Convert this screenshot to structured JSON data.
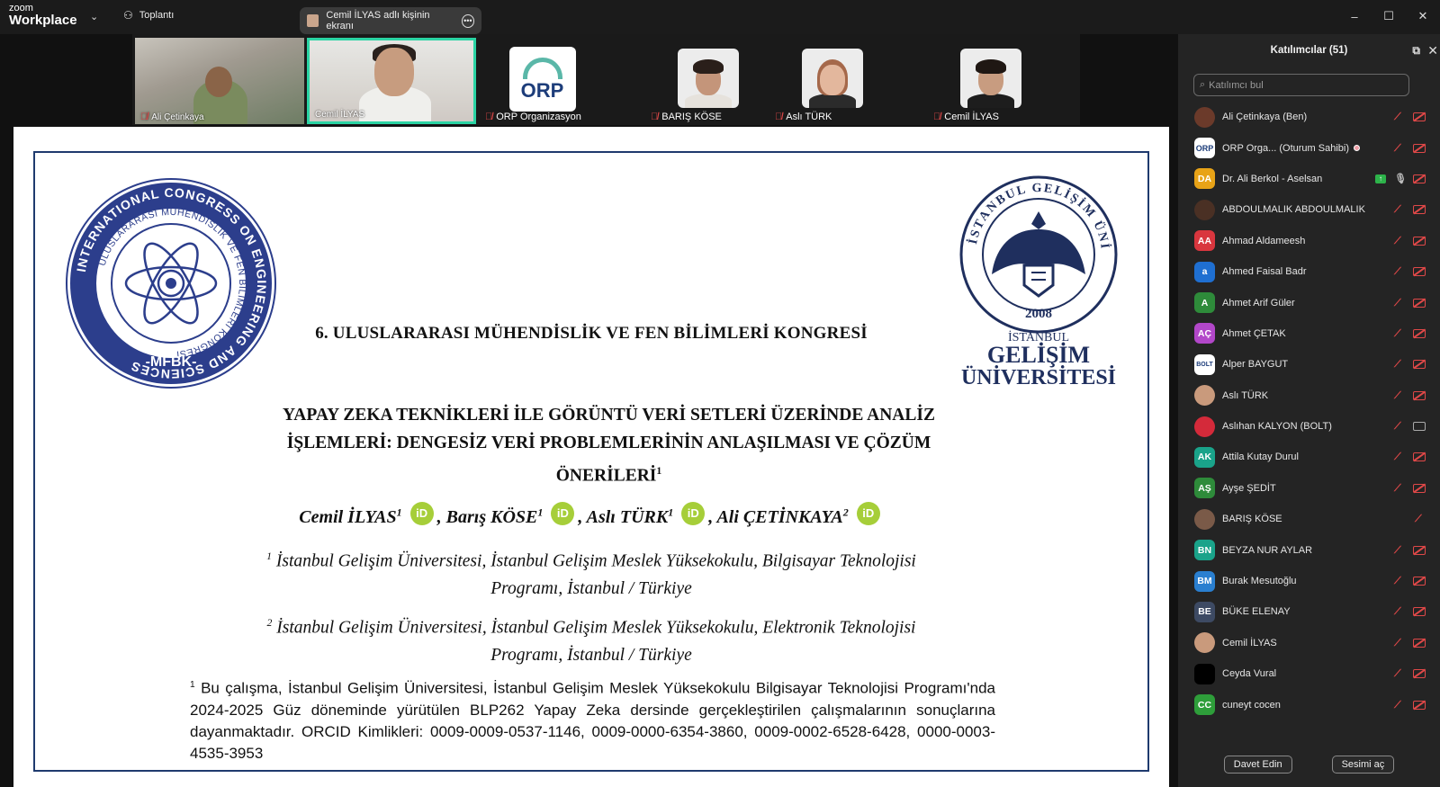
{
  "app": {
    "brand_small": "zoom",
    "brand_large": "Workplace",
    "meeting_menu_label": "Toplantı",
    "share_banner": "Cemil İLYAS adlı kişinin ekranı"
  },
  "video_strip": {
    "tiles": [
      {
        "name": "Ali Çetinkaya",
        "muted": true
      },
      {
        "name": "Cemil İLYAS",
        "muted": false,
        "active_speaker": true
      },
      {
        "name": "ORP Organizasyon",
        "muted": true,
        "logo_text": "ORP"
      },
      {
        "name": "BARIŞ KÖSE",
        "muted": true
      },
      {
        "name": "Aslı TÜRK",
        "muted": true
      },
      {
        "name": "Cemil İLYAS",
        "muted": true
      }
    ]
  },
  "document": {
    "conference_title": "6. ULUSLARARASI MÜHENDİSLİK VE FEN BİLİMLERİ KONGRESİ",
    "paper_title_line1": "YAPAY ZEKA TEKNİKLERİ İLE GÖRÜNTÜ VERİ SETLERİ ÜZERİNDE ANALİZ",
    "paper_title_line2": "İŞLEMLERİ: DENGESİZ VERİ PROBLEMLERİNİN ANLAŞILMASI VE ÇÖZÜM",
    "paper_title_line3": "ÖNERİLERİ",
    "authors": [
      {
        "name": "Cemil İLYAS",
        "sup": "1"
      },
      {
        "name": "Barış KÖSE",
        "sup": "1"
      },
      {
        "name": "Aslı TÜRK",
        "sup": "1"
      },
      {
        "name": "Ali ÇETİNKAYA",
        "sup": "2"
      }
    ],
    "orcid_glyph": "iD",
    "affiliation1_line1": "İstanbul Gelişim Üniversitesi, İstanbul Gelişim Meslek Yüksekokulu, Bilgisayar Teknolojisi",
    "affiliation1_line2": "Programı, İstanbul / Türkiye",
    "affiliation2_line1": "İstanbul Gelişim Üniversitesi, İstanbul Gelişim Meslek Yüksekokulu, Elektronik Teknolojisi",
    "affiliation2_line2": "Programı, İstanbul / Türkiye",
    "footnote": "Bu çalışma, İstanbul Gelişim Üniversitesi, İstanbul Gelişim Meslek Yüksekokulu Bilgisayar Teknolojisi Programı'nda 2024-2025 Güz döneminde yürütülen BLP262 Yapay Zeka dersinde gerçekleştirilen çalışmalarının sonuçlarına dayanmaktadır. ORCID Kimlikleri: 0009-0009-0537-1146, 0009-0000-6354-3860, 0009-0002-6528-6428, 0000-0003-4535-3953",
    "left_logo": {
      "outer_text": "INTERNATIONAL CONGRESS ON ENGINEERING AND SCIENCES",
      "inner_text": "ULUSLARARASI MÜHENDİSLİK VE FEN BİLİMLERİ KONGRESİ",
      "abbr": "-MFBK-"
    },
    "right_logo": {
      "ring_text": "İSTANBUL GELİŞİM ÜNİVERSİTESİ",
      "year": "2008",
      "city": "İSTANBUL",
      "name_line1": "GELİŞİM",
      "name_line2": "ÜNİVERSİTESİ"
    }
  },
  "participants_panel": {
    "title": "Katılımcılar (51)",
    "search_placeholder": "Katılımcı bul",
    "invite_label": "Davet Edin",
    "unmute_label": "Sesimi aç",
    "participants": [
      {
        "name": "Ali Çetinkaya (Ben)",
        "initials": "",
        "color": "#6b3a2a",
        "photo": true,
        "mic": "muted",
        "cam": "off-red"
      },
      {
        "name": "ORP Orga...  (Oturum Sahibi)",
        "initials": "ORP",
        "color": "#ffffff",
        "photo": false,
        "mic": "muted",
        "cam": "off-red",
        "extra_dot": true
      },
      {
        "name": "Dr. Ali Berkol - Aselsan",
        "initials": "DA",
        "color": "#e8a317",
        "photo": false,
        "mic": "on",
        "cam": "off-red",
        "sharing": true
      },
      {
        "name": "ABDOULMALIK ABDOULMALIK",
        "initials": "",
        "color": "#4a3024",
        "photo": true,
        "mic": "muted",
        "cam": "off-red"
      },
      {
        "name": "Ahmad Aldameesh",
        "initials": "AA",
        "color": "#d9363e",
        "photo": false,
        "mic": "muted",
        "cam": "off-red"
      },
      {
        "name": "Ahmed Faisal Badr",
        "initials": "a",
        "color": "#1f6fd1",
        "photo": false,
        "mic": "muted",
        "cam": "off-red"
      },
      {
        "name": "Ahmet Arif Güler",
        "initials": "A",
        "color": "#2e8b3a",
        "photo": false,
        "mic": "muted",
        "cam": "off-red"
      },
      {
        "name": "Ahmet ÇETAK",
        "initials": "AÇ",
        "color": "#b247c9",
        "photo": false,
        "mic": "muted",
        "cam": "off-red"
      },
      {
        "name": "Alper BAYGUT",
        "initials": "BOLT",
        "color": "#ffffff",
        "photo": false,
        "mic": "muted",
        "cam": "off-red"
      },
      {
        "name": "Aslı TÜRK",
        "initials": "",
        "color": "#c99a7c",
        "photo": true,
        "mic": "muted",
        "cam": "off-red"
      },
      {
        "name": "Aslıhan KALYON (BOLT)",
        "initials": "",
        "color": "#d42a3a",
        "photo": true,
        "mic": "muted",
        "cam": "off-gray"
      },
      {
        "name": "Attila Kutay Durul",
        "initials": "AK",
        "color": "#1aa38a",
        "photo": false,
        "mic": "muted",
        "cam": "off-red"
      },
      {
        "name": "Ayşe ŞEDİT",
        "initials": "AŞ",
        "color": "#2e8b3a",
        "photo": false,
        "mic": "muted",
        "cam": "off-red"
      },
      {
        "name": "BARIŞ KÖSE",
        "initials": "",
        "color": "#7a5a48",
        "photo": true,
        "mic": "muted",
        "cam": "none"
      },
      {
        "name": "BEYZA NUR AYLAR",
        "initials": "BN",
        "color": "#1aa38a",
        "photo": false,
        "mic": "muted",
        "cam": "off-red"
      },
      {
        "name": "Burak Mesutoğlu",
        "initials": "BM",
        "color": "#2a7fd0",
        "photo": false,
        "mic": "muted",
        "cam": "off-red"
      },
      {
        "name": "BÜKE ELENAY",
        "initials": "BE",
        "color": "#3d4a63",
        "photo": false,
        "mic": "muted",
        "cam": "off-red"
      },
      {
        "name": "Cemil İLYAS",
        "initials": "",
        "color": "#c99a7c",
        "photo": true,
        "mic": "muted",
        "cam": "off-red"
      },
      {
        "name": "Ceyda Vural",
        "initials": "",
        "color": "#000000",
        "photo": false,
        "mic": "muted",
        "cam": "off-red"
      },
      {
        "name": "cuneyt cocen",
        "initials": "CC",
        "color": "#2e9e3a",
        "photo": false,
        "mic": "muted",
        "cam": "off-red"
      }
    ]
  },
  "window_controls": {
    "minimize": "–",
    "maximize": "☐",
    "close": "✕"
  }
}
